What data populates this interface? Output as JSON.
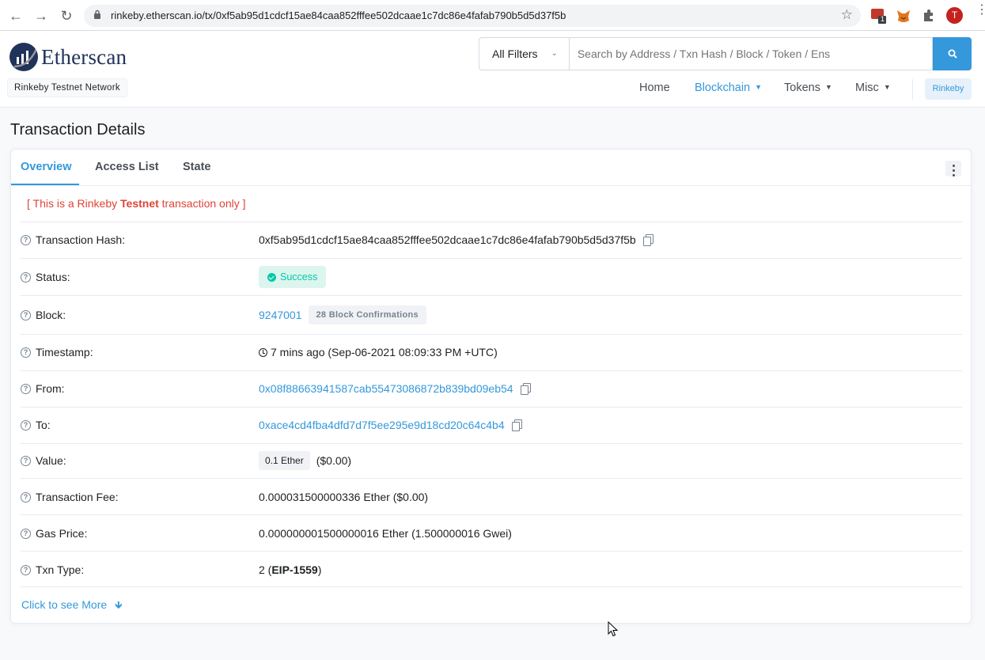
{
  "browser": {
    "url": "rinkeby.etherscan.io/tx/0xf5ab95d1cdcf15ae84caa852fffee502dcaae1c7dc86e4fafab790b5d5d37f5b",
    "profile_initial": "T",
    "extension_badge": "1"
  },
  "header": {
    "logo_text": "Etherscan",
    "network_label": "Rinkeby Testnet Network",
    "filter_label": "All Filters",
    "search_placeholder": "Search by Address / Txn Hash / Block / Token / Ens",
    "nav": {
      "home": "Home",
      "blockchain": "Blockchain",
      "tokens": "Tokens",
      "misc": "Misc",
      "network_pill": "Rinkeby"
    }
  },
  "page_title": "Transaction Details",
  "tabs": {
    "overview": "Overview",
    "access_list": "Access List",
    "state": "State"
  },
  "testnet_note": {
    "prefix": "[ This is a Rinkeby ",
    "bold": "Testnet",
    "suffix": " transaction only ]"
  },
  "details": {
    "hash_label": "Transaction Hash:",
    "hash": "0xf5ab95d1cdcf15ae84caa852fffee502dcaae1c7dc86e4fafab790b5d5d37f5b",
    "status_label": "Status:",
    "status": "Success",
    "block_label": "Block:",
    "block": "9247001",
    "confirmations": "28 Block Confirmations",
    "timestamp_label": "Timestamp:",
    "timestamp": "7 mins ago (Sep-06-2021 08:09:33 PM +UTC)",
    "from_label": "From:",
    "from": "0x08f88663941587cab55473086872b839bd09eb54",
    "to_label": "To:",
    "to": "0xace4cd4fba4dfd7d7f5ee295e9d18cd20c64c4b4",
    "value_label": "Value:",
    "value_badge": "0.1 Ether",
    "value_usd": "($0.00)",
    "fee_label": "Transaction Fee:",
    "fee": "0.000031500000336 Ether ($0.00)",
    "gas_label": "Gas Price:",
    "gas": "0.000000001500000016 Ether (1.500000016 Gwei)",
    "type_label": "Txn Type:",
    "type_num": "2 (",
    "type_name": "EIP-1559",
    "type_close": ")"
  },
  "see_more": "Click to see More",
  "colors": {
    "accent": "#3498db",
    "success": "#00c9a7",
    "danger": "#de4437",
    "brand": "#21325b"
  }
}
